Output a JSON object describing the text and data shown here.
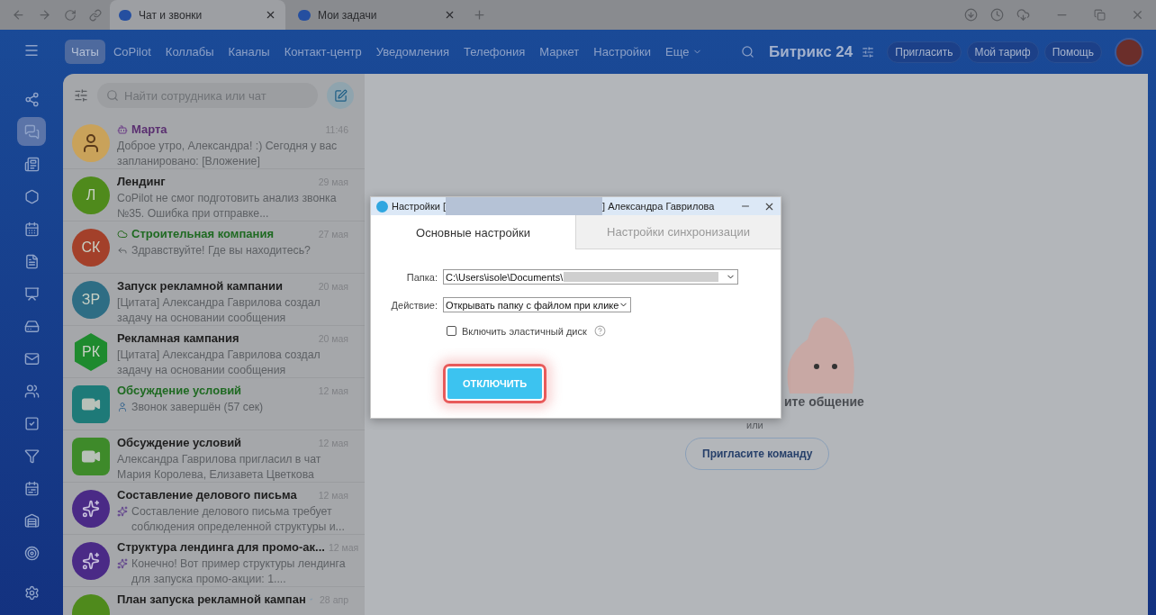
{
  "browser": {
    "tabs": [
      {
        "label": "Чат и звонки",
        "selected": true
      },
      {
        "label": "Мои задачи",
        "selected": false
      }
    ]
  },
  "header": {
    "nav": [
      {
        "label": "Чаты",
        "selected": true
      },
      {
        "label": "CoPilot",
        "selected": false
      },
      {
        "label": "Коллабы",
        "selected": false
      },
      {
        "label": "Каналы",
        "selected": false
      },
      {
        "label": "Контакт-центр",
        "selected": false
      },
      {
        "label": "Уведомления",
        "selected": false
      },
      {
        "label": "Телефония",
        "selected": false
      },
      {
        "label": "Маркет",
        "selected": false
      },
      {
        "label": "Настройки",
        "selected": false
      },
      {
        "label": "Еще",
        "selected": false
      }
    ],
    "logo": "Битрикс 24",
    "buttons": [
      "Пригласить",
      "Мой тариф",
      "Помощь"
    ]
  },
  "rail": [
    {
      "selected": false
    },
    {
      "selected": true
    },
    {
      "selected": false
    },
    {
      "selected": false
    },
    {
      "selected": false
    },
    {
      "selected": false
    },
    {
      "selected": false
    },
    {
      "selected": false
    },
    {
      "selected": false
    },
    {
      "selected": false
    },
    {
      "selected": false
    },
    {
      "selected": false
    },
    {
      "selected": false
    },
    {
      "selected": false
    },
    {
      "selected": false
    },
    {
      "selected": false
    }
  ],
  "chat_list": {
    "search": {
      "placeholder": "Найти сотрудника или чат"
    },
    "items": [
      {
        "avatar": {
          "kind": "character",
          "color": "#c9a25a"
        },
        "title": "Марта",
        "color": "#5a2f70",
        "badge": {
          "kind": "bot"
        },
        "time": "11:46",
        "preview": "Доброе утро, Александра! :) Сегодня у вас запланировано: [Вложение]"
      },
      {
        "avatar": {
          "kind": "initials",
          "text": "Л",
          "color": "#4f8a1c"
        },
        "title": "Лендинг",
        "color": "#1e1e1e",
        "time": "29 мая",
        "preview": "CoPilot не смог подготовить анализ звонка №35. Ошибка при отправке..."
      },
      {
        "avatar": {
          "kind": "initials",
          "text": "СК",
          "color": "#a3402a"
        },
        "title": "Строительная компания",
        "color": "#1f6a22",
        "badge": {
          "kind": "extranet"
        },
        "time": "27 мая",
        "preview": "Здравствуйте! Где вы находитесь?",
        "preview_icon": {
          "kind": "reply"
        }
      },
      {
        "avatar": {
          "kind": "initials",
          "text": "ЗР",
          "color": "#2e6d84"
        },
        "title": "Запуск рекламной кампании",
        "color": "#1e1e1e",
        "time": "20 мая",
        "preview": "[Цитата] Александра Гаврилова создал задачу на основании сообщения"
      },
      {
        "avatar": {
          "kind": "hexagon",
          "text": "РК",
          "color": "#1e8a2e"
        },
        "title": "Рекламная кампания",
        "color": "#1e1e1e",
        "time": "20 мая",
        "preview": "[Цитата] Александра Гаврилова создал задачу на основании сообщения"
      },
      {
        "avatar": {
          "kind": "video",
          "color": "#1e7a78"
        },
        "title": "Обсуждение условий",
        "color": "#1f6a22",
        "time": "12 мая",
        "preview": "Звонок завершён (57 сек)",
        "preview_icon": {
          "kind": "user"
        }
      },
      {
        "avatar": {
          "kind": "video",
          "color": "#3e8a2a"
        },
        "title": "Обсуждение условий",
        "color": "#1e1e1e",
        "time": "12 мая",
        "preview": "Александра Гаврилова пригласил в чат Мария Королева, Елизавета Цветкова"
      },
      {
        "avatar": {
          "kind": "copilot",
          "color": "#4a2a86"
        },
        "title": "Составление делового письма",
        "color": "#1e1e1e",
        "time": "12 мая",
        "preview": "Составление делового письма требует соблюдения определенной структуры и...",
        "preview_icon": {
          "kind": "copilot"
        }
      },
      {
        "avatar": {
          "kind": "copilot",
          "color": "#4a2a86"
        },
        "title": "Структура лендинга для промо-ак...",
        "color": "#1e1e1e",
        "time": "12 мая",
        "preview": "Конечно! Вот пример структуры лендинга для запуска промо-акции: 1....",
        "preview_icon": {
          "kind": "copilot"
        }
      },
      {
        "avatar": {
          "kind": "initials",
          "color": "#4f8a1c"
        },
        "title": "План запуска рекламной кампан",
        "color": "#1e1e1e",
        "time": "28 апр",
        "read": true
      }
    ]
  },
  "empty_state": {
    "heading": "ите общение",
    "or": "или",
    "button": "Пригласите команду"
  },
  "dialog": {
    "title_start": "Настройки [",
    "title_end": "] Александра Гаврилова",
    "tabs": [
      {
        "label": "Основные настройки",
        "selected": true
      },
      {
        "label": "Настройки синхронизации",
        "selected": false
      }
    ],
    "fields": [
      {
        "label": "Папка:",
        "value": "C:\\Users\\isole\\Documents\\",
        "redacted": true
      },
      {
        "label": "Действие:",
        "value": "Открывать папку с файлом при клике",
        "redacted": false
      }
    ],
    "checkbox": {
      "label": "Включить эластичный диск",
      "checked": false
    },
    "button": {
      "label": "ОТКЛЮЧИТЬ",
      "highlighted": true
    }
  }
}
